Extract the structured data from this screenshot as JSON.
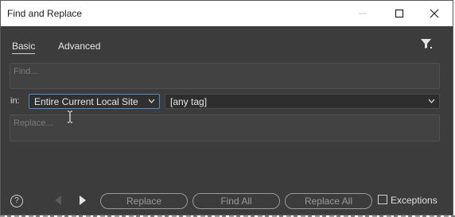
{
  "window": {
    "title": "Find and Replace"
  },
  "tabs": [
    {
      "label": "Basic",
      "active": true
    },
    {
      "label": "Advanced",
      "active": false
    }
  ],
  "find": {
    "placeholder": "Find..."
  },
  "scope": {
    "in_label": "in:",
    "selected": "Entire Current Local Site",
    "tag": "[any tag]"
  },
  "replace": {
    "placeholder": "Replace..."
  },
  "footer": {
    "help": "?",
    "replace_label": "Replace",
    "find_all_label": "Find All",
    "replace_all_label": "Replace All",
    "exceptions_label": "Exceptions"
  },
  "icons": {
    "minimize": "minimize-icon",
    "maximize": "maximize-icon",
    "close": "close-icon",
    "filter": "filter-icon",
    "prev": "triangle-left-icon",
    "next": "triangle-right-icon",
    "dropdown": "chevron-down-icon"
  },
  "colors": {
    "panel_bg": "#3c3c3c",
    "accent_border": "#4a90d9",
    "text": "#e6e6e6"
  }
}
